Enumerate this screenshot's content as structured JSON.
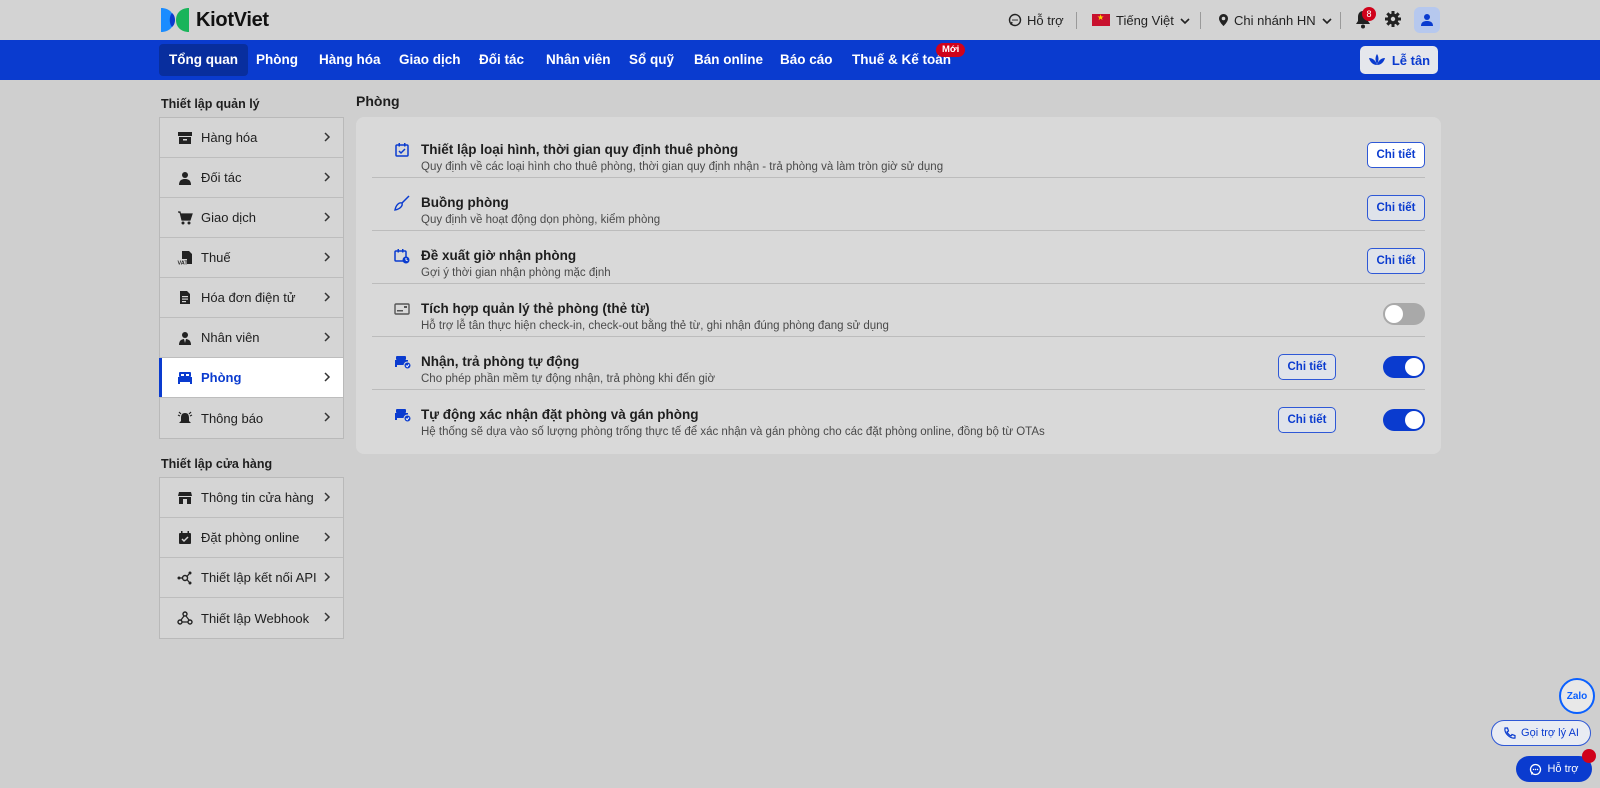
{
  "brand": {
    "name": "KiotViet"
  },
  "topbar": {
    "support": "Hỗ trợ",
    "language": "Tiếng Việt",
    "branch": "Chi nhánh HN",
    "notification_count": "8"
  },
  "nav": {
    "items": [
      "Tổng quan",
      "Phòng",
      "Hàng hóa",
      "Giao dịch",
      "Đối tác",
      "Nhân viên",
      "Sổ quỹ",
      "Bán online",
      "Báo cáo",
      "Thuế & Kế toán"
    ],
    "new_badge": "Mới",
    "reception": "Lễ tân"
  },
  "sidebar": {
    "group1_title": "Thiết lập quản lý",
    "group1": [
      "Hàng hóa",
      "Đối tác",
      "Giao dịch",
      "Thuế",
      "Hóa đơn điện tử",
      "Nhân viên",
      "Phòng",
      "Thông báo"
    ],
    "group2_title": "Thiết lập cửa hàng",
    "group2": [
      "Thông tin cửa hàng",
      "Đặt phòng online",
      "Thiết lập kết nối API",
      "Thiết lập Webhook"
    ],
    "active": "Phòng"
  },
  "main": {
    "title": "Phòng",
    "detail_label": "Chi tiết",
    "rows": [
      {
        "title": "Thiết lập loại hình, thời gian quy định thuê phòng",
        "desc": "Quy định về các loại hình cho thuê phòng, thời gian quy định nhận - trả phòng và làm tròn giờ sử dụng",
        "icon": "calendar-check-icon",
        "toggle": null
      },
      {
        "title": "Buồng phòng",
        "desc": "Quy định về hoạt động dọn phòng, kiểm phòng",
        "icon": "broom-icon",
        "toggle": null
      },
      {
        "title": "Đề xuất giờ nhận phòng",
        "desc": "Gợi ý thời gian nhận phòng mặc định",
        "icon": "calendar-clock-icon",
        "toggle": null
      },
      {
        "title": "Tích hợp quản lý thẻ phòng (thẻ từ)",
        "desc": "Hỗ trợ lễ tân thực hiện check-in, check-out bằng thẻ từ, ghi nhận đúng phòng đang sử dụng",
        "icon": "key-card-icon",
        "toggle": "off"
      },
      {
        "title": "Nhận, trả phòng tự động",
        "desc": "Cho phép phần mềm tự động nhận, trả phòng khi đến giờ",
        "icon": "bed-auto-icon",
        "toggle": "on"
      },
      {
        "title": "Tự động xác nhận đặt phòng và gán phòng",
        "desc": "Hệ thống sẽ dựa vào số lượng phòng trống thực tế để xác nhận và gán phòng cho các đặt phòng online, đồng bộ từ OTAs",
        "icon": "bed-auto-icon",
        "toggle": "on"
      }
    ]
  },
  "floating": {
    "zalo": "Zalo",
    "ai_assistant": "Gọi trợ lý AI",
    "help": "Hỗ trợ"
  },
  "colors": {
    "primary": "#0a3bcf",
    "badge": "#d0021b"
  }
}
